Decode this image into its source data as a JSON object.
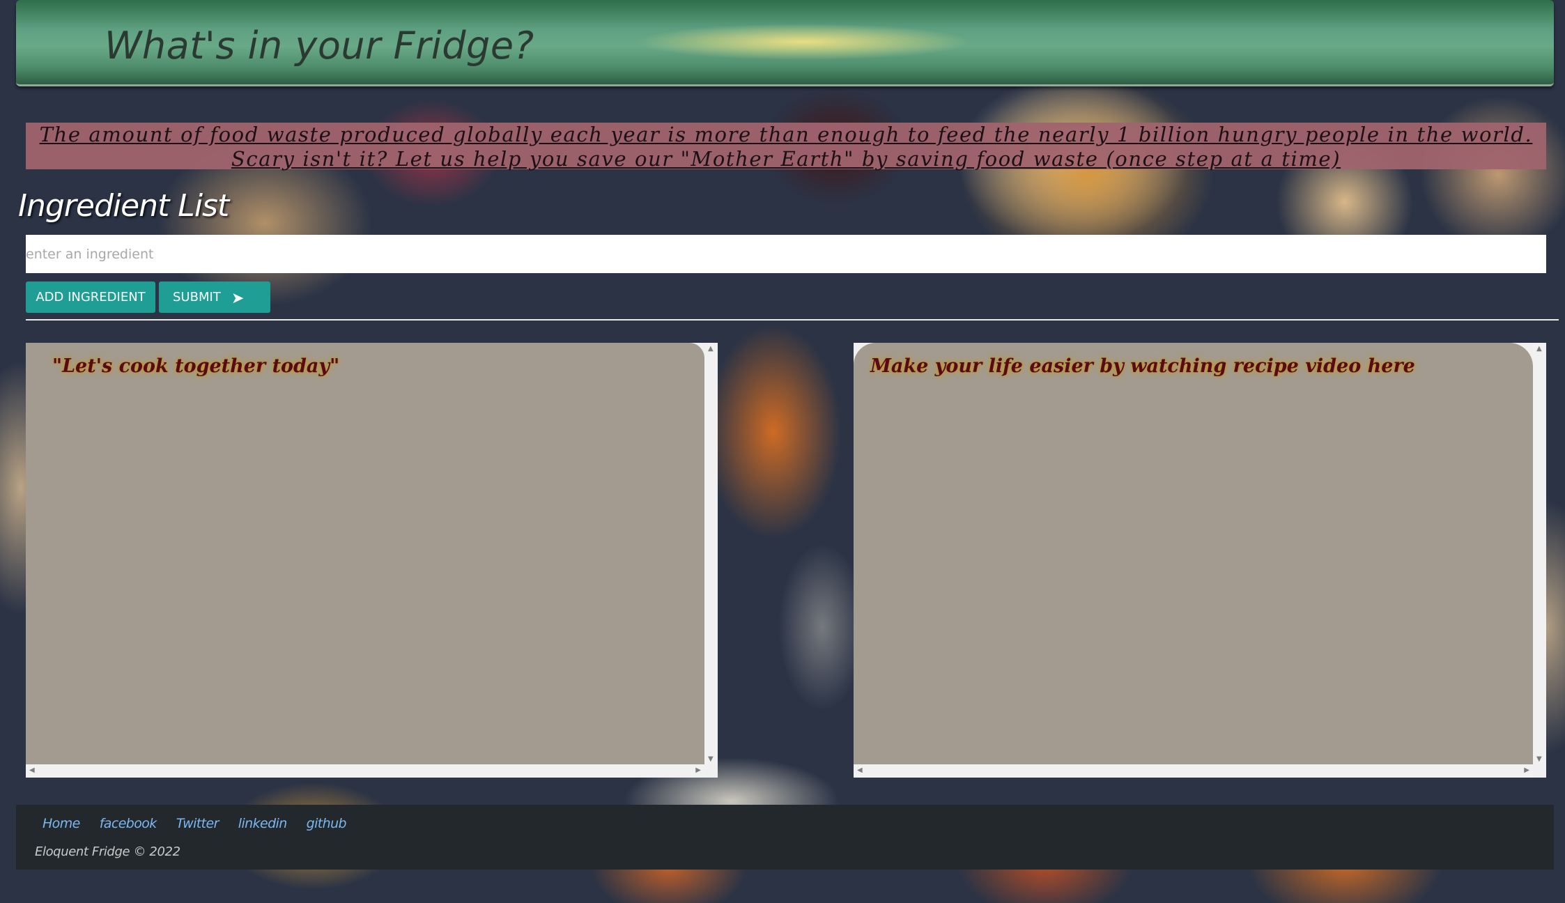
{
  "header": {
    "title": "What's in your Fridge?"
  },
  "banner": {
    "text": "The amount of food waste produced globally each year is more than enough to feed the nearly 1 billion hungry people in the world. Scary isn't it? Let us help you save our \"Mother Earth\" by saving food waste (once step at a time)"
  },
  "ingredients": {
    "title": "Ingredient List",
    "input_placeholder": "enter an ingredient",
    "input_value": "",
    "add_label": "ADD INGREDIENT",
    "submit_label": "SUBMIT",
    "submit_icon": "paper-plane-arrow"
  },
  "panels": {
    "left_title": "\"Let's cook together today\"",
    "right_title": "Make your life easier by watching recipe video here"
  },
  "footer": {
    "links": [
      "Home",
      "facebook",
      "Twitter",
      "linkedin",
      "github"
    ],
    "copyright": "Eloquent Fridge © 2022"
  },
  "colors": {
    "header_green": "#5ea081",
    "banner_rose": "#a0646e",
    "button_teal": "#1f9e95",
    "panel_taupe": "#a39b90",
    "footer_dark": "#23282d",
    "link_blue": "#7bb8f0"
  }
}
